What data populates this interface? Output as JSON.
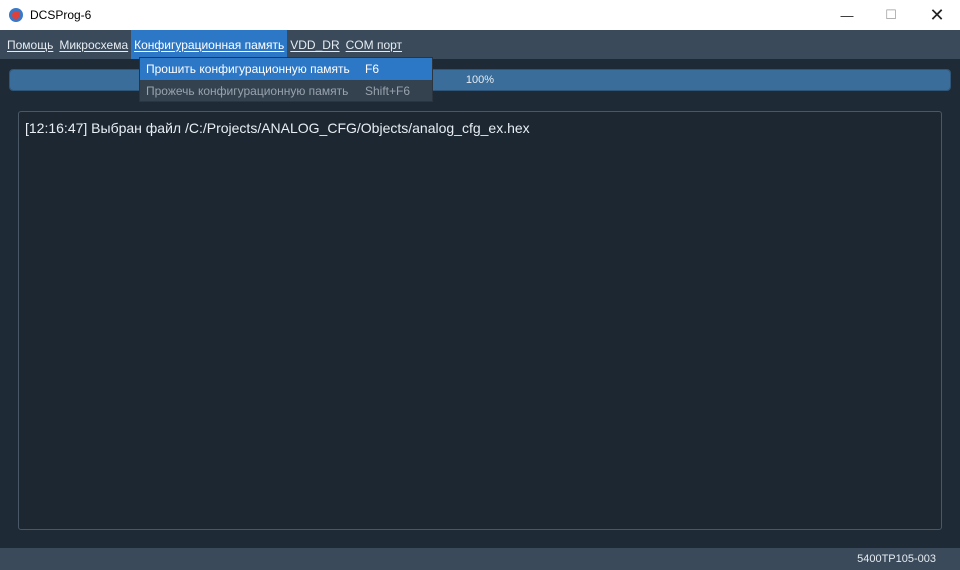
{
  "window": {
    "title": "DCSProg-6",
    "minimize_glyph": "—",
    "maximize_glyph": "☐",
    "close_glyph": "✕"
  },
  "menubar": {
    "items": [
      {
        "label": "Помощь"
      },
      {
        "label": "Микросхема"
      },
      {
        "label": "Конфигурационная память"
      },
      {
        "label": "VDD_DR"
      },
      {
        "label": "COM порт"
      }
    ]
  },
  "dropdown": {
    "items": [
      {
        "label": "Прошить конфигурационную память",
        "shortcut": "F6",
        "state": "highlighted"
      },
      {
        "label": "Прожечь конфигурационную память",
        "shortcut": "Shift+F6",
        "state": "disabled"
      }
    ]
  },
  "progress": {
    "value": 100,
    "text": "100%"
  },
  "log": {
    "lines": [
      "[12:16:47] Выбран файл /C:/Projects/ANALOG_CFG/Objects/analog_cfg_ex.hex"
    ]
  },
  "status": {
    "text": "5400ТР105-003"
  },
  "colors": {
    "accent": "#2d77c7",
    "menubar": "#3a4a5a",
    "background": "#1e2a35"
  }
}
